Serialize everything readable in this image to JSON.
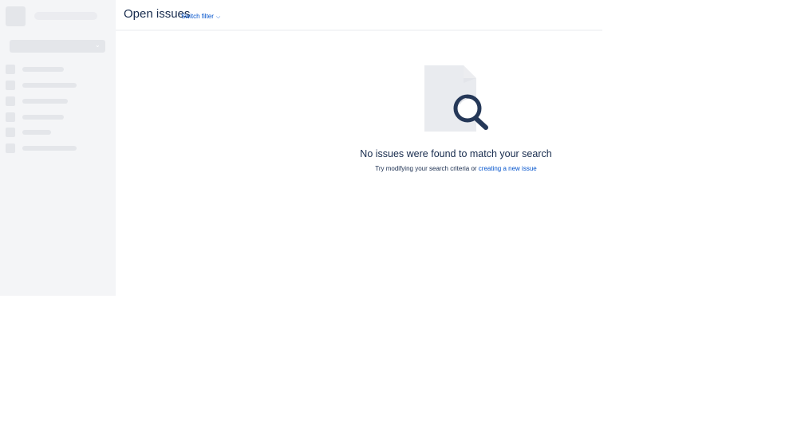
{
  "header": {
    "title": "Open issues",
    "switch_filter_label": "Switch filter"
  },
  "sidebar": {
    "loading": true,
    "placeholder_rows": 6
  },
  "empty_state": {
    "title": "No issues were found to match your search",
    "subtitle_prefix": "Try modifying your search criteria or",
    "create_link": "creating a new issue",
    "illustration": "document-search-icon"
  },
  "colors": {
    "link": "#0052cc",
    "text": "#172b4d",
    "sidebar_bg": "#f4f5f7",
    "skeleton": "#e4e6ea",
    "magnifier": "#253858"
  }
}
